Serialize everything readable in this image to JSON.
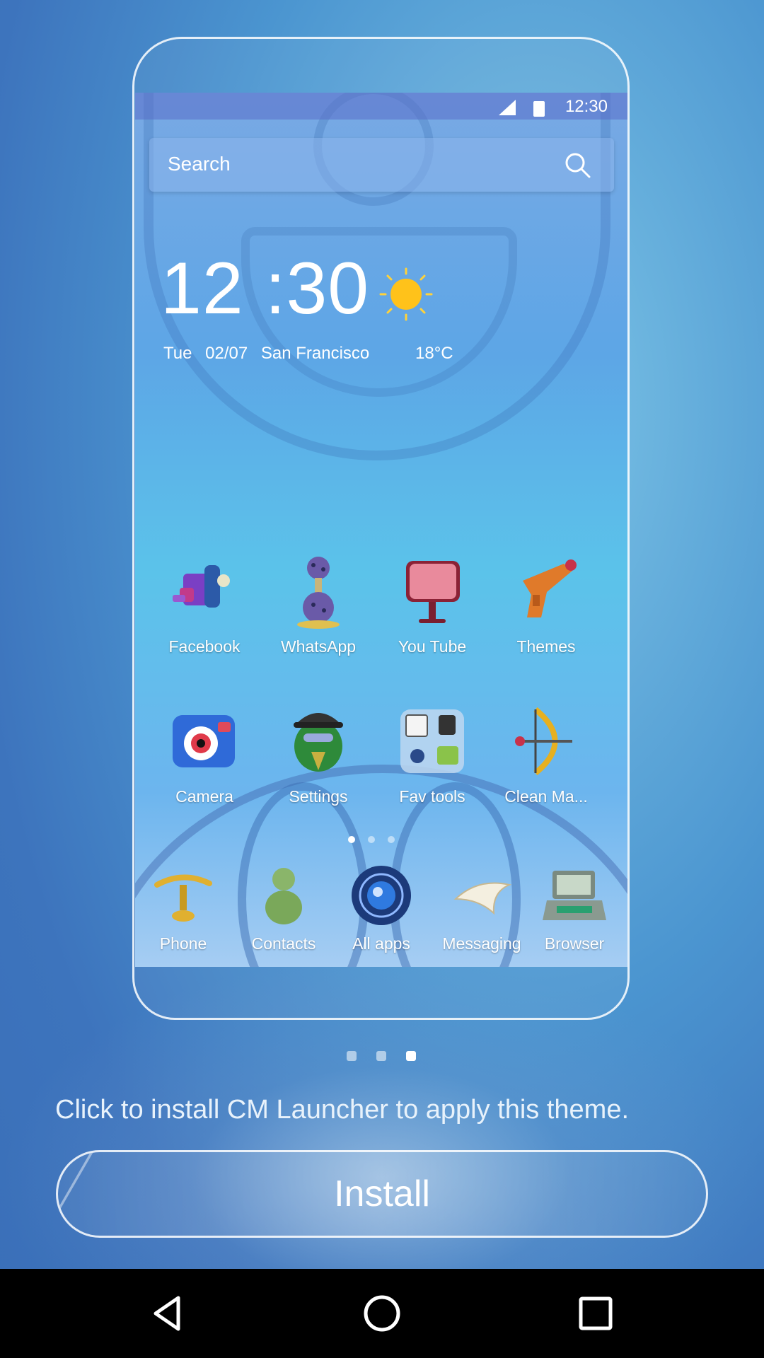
{
  "statusbar": {
    "time": "12:30",
    "signal_icon": "signal-icon",
    "battery_icon": "battery-icon"
  },
  "search": {
    "label": "Search",
    "icon": "search-icon"
  },
  "clock_widget": {
    "time": "12 :30",
    "weather_icon": "sun-icon",
    "day": "Tue",
    "date": "02/07",
    "city": "San Francisco",
    "temperature": "18°C"
  },
  "apps_row1": [
    {
      "label": "Facebook",
      "icon": "facebook-icon"
    },
    {
      "label": "WhatsApp",
      "icon": "whatsapp-icon"
    },
    {
      "label": "You Tube",
      "icon": "youtube-icon"
    },
    {
      "label": "Themes",
      "icon": "themes-icon"
    }
  ],
  "apps_row2": [
    {
      "label": "Camera",
      "icon": "camera-icon"
    },
    {
      "label": "Settings",
      "icon": "settings-icon"
    },
    {
      "label": "Fav tools",
      "icon": "fav-tools-icon"
    },
    {
      "label": "Clean Ma...",
      "icon": "clean-master-icon"
    }
  ],
  "dock": [
    {
      "label": "Phone",
      "icon": "phone-icon"
    },
    {
      "label": "Contacts",
      "icon": "contacts-icon"
    },
    {
      "label": "All apps",
      "icon": "all-apps-icon"
    },
    {
      "label": "Messaging",
      "icon": "messaging-icon"
    },
    {
      "label": "Browser",
      "icon": "browser-icon"
    }
  ],
  "preview_page_index": {
    "current": 1,
    "total": 3
  },
  "pager": {
    "current": 3,
    "total": 3
  },
  "install_message": "Click to install CM Launcher to apply this theme.",
  "install_button": "Install",
  "navbar": {
    "back_icon": "back-icon",
    "home_icon": "home-icon",
    "recents_icon": "recents-icon"
  }
}
